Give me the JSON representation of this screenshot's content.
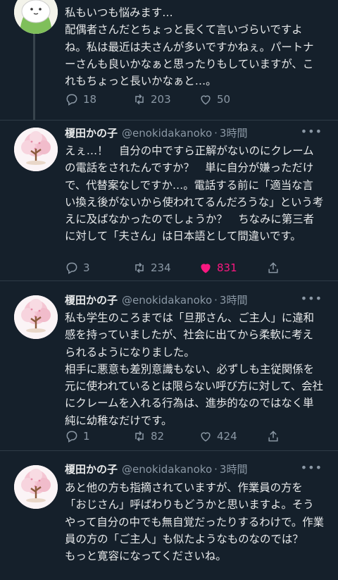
{
  "tweets": [
    {
      "body": "私もいつも悩みます…\n配偶者さんだとちょっと長くて言いづらいですよね。私は最近は夫さんが多いですかねぇ。パートナーさんも良いかなぁと思ったりもしていますが、これもちょっと長いかなぁと…。",
      "replies": "18",
      "retweets": "203",
      "likes": "50"
    },
    {
      "name": "榎田かの子",
      "handle": "@enokidakanoko",
      "time": "3時間",
      "body": "えぇ…！　自分の中ですら正解がないのにクレームの電話をされたんですか？　単に自分が嫌っただけで、代替案なしですか…。電話する前に「適当な言い換え後がないから使われてるんだろうな」という考えに及ばなかったのでしょうか？　ちなみに第三者に対して「夫さん」は日本語として間違いです。",
      "replies": "3",
      "retweets": "234",
      "likes": "831"
    },
    {
      "name": "榎田かの子",
      "handle": "@enokidakanoko",
      "time": "3時間",
      "body": "私も学生のころまでは「旦那さん、ご主人」に違和感を持っていましたが、社会に出てから柔軟に考えられるようになりました。\n相手に悪意も差別意識もない、必ずしも主従関係を元に使われているとは限らない呼び方に対して、会社にクレームを入れる行為は、進歩的なのではなく単純に幼稚なだけです。",
      "replies": "1",
      "retweets": "82",
      "likes": "424"
    },
    {
      "name": "榎田かの子",
      "handle": "@enokidakanoko",
      "time": "3時間",
      "body": "あと他の方も指摘されていますが、作業員の方を「おじさん」呼ばわりもどうかと思いますよ。そうやって自分の中でも無自覚だったりするわけで。作業員の方の「ご主人」も似たようなものなのでは？　もっと寛容になってくださいね。"
    }
  ],
  "colors": {
    "background": "#15202b",
    "text": "#e7e9ea",
    "muted": "#8b98a5",
    "like": "#f91880"
  }
}
